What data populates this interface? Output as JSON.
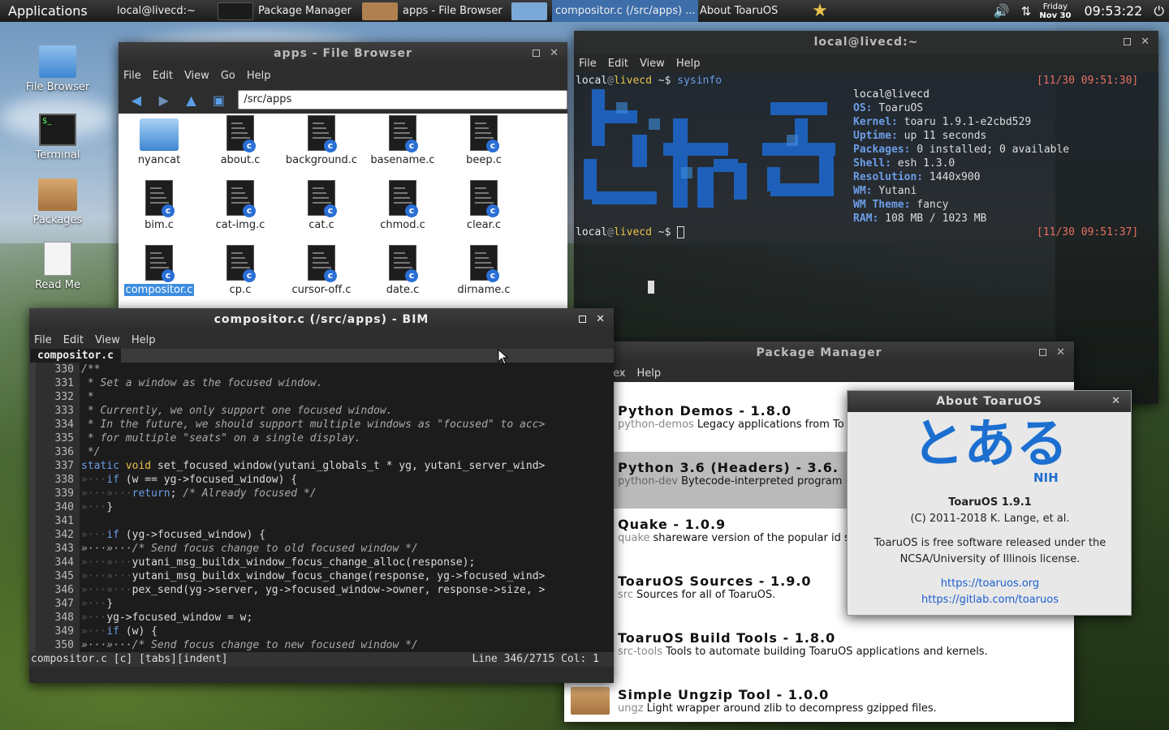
{
  "panel": {
    "apps_label": "Applications",
    "tasks": [
      "local@livecd:~",
      "Package Manager",
      "apps - File Browser",
      "compositor.c (/src/apps) ...",
      "About ToaruOS"
    ],
    "date_day": "Friday",
    "date": "Nov 30",
    "clock": "09:53:22"
  },
  "desktop": {
    "icons": [
      "File Browser",
      "Terminal",
      "Packages",
      "Read Me"
    ]
  },
  "file_browser": {
    "title": "apps - File Browser",
    "menu": [
      "File",
      "Edit",
      "View",
      "Go",
      "Help"
    ],
    "path": "/src/apps",
    "files": [
      "nyancat",
      "about.c",
      "background.c",
      "basename.c",
      "beep.c",
      "bim.c",
      "cat-img.c",
      "cat.c",
      "chmod.c",
      "clear.c",
      "compositor.c",
      "cp.c",
      "cursor-off.c",
      "date.c",
      "dirname.c"
    ],
    "selected": "compositor.c"
  },
  "terminal": {
    "title": "local@livecd:~",
    "menu": [
      "File",
      "Edit",
      "View",
      "Help"
    ],
    "prompt_user": "local",
    "prompt_at": "@",
    "prompt_host": "livecd",
    "prompt_rest": " ~$ ",
    "command": "sysinfo",
    "timestamp1": "[11/30 09:51:30]",
    "timestamp2": "[11/30 09:51:37]",
    "sysinfo_header": "local@livecd",
    "sysinfo": [
      {
        "key": "OS:",
        "value": "ToaruOS"
      },
      {
        "key": "Kernel:",
        "value": "toaru 1.9.1-e2cbd529"
      },
      {
        "key": "Uptime:",
        "value": "up 11 seconds"
      },
      {
        "key": "Packages:",
        "value": "0 installed; 0 available"
      },
      {
        "key": "Shell:",
        "value": "esh 1.3.0"
      },
      {
        "key": "Resolution:",
        "value": "1440x900"
      },
      {
        "key": "WM:",
        "value": "Yutani"
      },
      {
        "key": "WM Theme:",
        "value": "fancy"
      },
      {
        "key": "RAM:",
        "value": "108 MB / 1023 MB"
      }
    ]
  },
  "editor": {
    "title": "compositor.c (/src/apps) - BIM",
    "menu": [
      "File",
      "Edit",
      "View",
      "Help"
    ],
    "tab": "compositor.c",
    "status_left": "compositor.c [c] [tabs][indent]",
    "status_right": "Line 346/2715 Col: 1",
    "lines": [
      {
        "n": "330",
        "t": "/**"
      },
      {
        "n": "331",
        "t": " * Set a window as the focused window."
      },
      {
        "n": "332",
        "t": " *"
      },
      {
        "n": "333",
        "t": " * Currently, we only support one focused window."
      },
      {
        "n": "334",
        "t": " * In the future, we should support multiple windows as \"focused\" to acc>"
      },
      {
        "n": "335",
        "t": " * for multiple \"seats\" on a single display."
      },
      {
        "n": "336",
        "t": " */"
      },
      {
        "n": "337",
        "t": "static void set_focused_window(yutani_globals_t * yg, yutani_server_wind>"
      },
      {
        "n": "338",
        "t": "»···if (w == yg->focused_window) {"
      },
      {
        "n": "339",
        "t": "»···»···return; /* Already focused */"
      },
      {
        "n": "340",
        "t": "»···}"
      },
      {
        "n": "341",
        "t": ""
      },
      {
        "n": "342",
        "t": "»···if (yg->focused_window) {"
      },
      {
        "n": "343",
        "t": "»···»···/* Send focus change to old focused window */"
      },
      {
        "n": "344",
        "t": "»···»···yutani_msg_buildx_window_focus_change_alloc(response);"
      },
      {
        "n": "345",
        "t": "»···»···yutani_msg_buildx_window_focus_change(response, yg->focused_wind>"
      },
      {
        "n": "346",
        "t": "»···»···pex_send(yg->server, yg->focused_window->owner, response->size, >"
      },
      {
        "n": "347",
        "t": "»···}"
      },
      {
        "n": "348",
        "t": "»···yg->focused_window = w;"
      },
      {
        "n": "349",
        "t": "»···if (w) {"
      },
      {
        "n": "350",
        "t": "»···»···/* Send focus change to new focused window */"
      }
    ]
  },
  "package_manager": {
    "title": "Package Manager",
    "menu": [
      "ex",
      "Help"
    ],
    "packages": [
      {
        "name": "Python Demos - 1.8.0",
        "id": "python-demos",
        "desc": "Legacy applications from To"
      },
      {
        "name": "Python 3.6 (Headers) - 3.6.",
        "id": "python-dev",
        "desc": "Bytecode-interpreted program"
      },
      {
        "name": "Quake - 1.0.9",
        "id": "quake",
        "desc": "shareware version of the popular id s"
      },
      {
        "name": "ToaruOS Sources - 1.9.0",
        "id": "src",
        "desc": "Sources for all of ToaruOS."
      },
      {
        "name": "ToaruOS Build Tools - 1.8.0",
        "id": "src-tools",
        "desc": "Tools to automate building ToaruOS applications and kernels."
      },
      {
        "name": "Simple Ungzip Tool - 1.0.0",
        "id": "ungz",
        "desc": "Light wrapper around zlib to decompress gzipped files."
      }
    ]
  },
  "about": {
    "title": "About ToaruOS",
    "logo_text": "とある",
    "logo_sub": "NIH",
    "version": "ToaruOS 1.9.1",
    "copyright": "(C) 2011-2018 K. Lange,  et al.",
    "license1": "ToaruOS is free software released under the",
    "license2": "NCSA/University of Illinois license.",
    "link1": "https://toaruos.org",
    "link2": "https://gitlab.com/toaruos"
  },
  "colors": {
    "accent": "#3d8ee0",
    "terminal_user": "#e8e8e8",
    "terminal_host": "#e6c24b",
    "terminal_key": "#6d9ee8",
    "timestamp": "#e87060",
    "link": "#1c5fd0"
  }
}
